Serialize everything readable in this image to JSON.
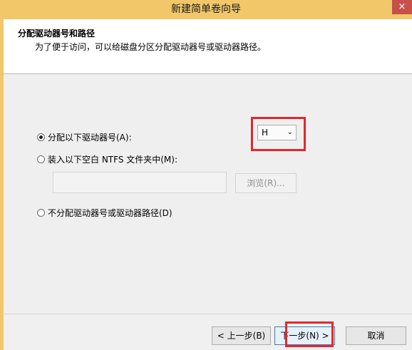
{
  "window": {
    "title": "新建简单卷向导",
    "close_icon": "×"
  },
  "header": {
    "title": "分配驱动器号和路径",
    "subtitle": "为了便于访问，可以给磁盘分区分配驱动器号或驱动器路径。"
  },
  "options": {
    "assign_letter": {
      "label": "分配以下驱动器号(A):",
      "selected": true
    },
    "mount_folder": {
      "label": "装入以下空白 NTFS 文件夹中(M):",
      "selected": false
    },
    "no_assign": {
      "label": "不分配驱动器号或驱动器路径(D)",
      "selected": false
    }
  },
  "drive_letter": {
    "value": "H",
    "chevron": "⌄"
  },
  "browse_button": {
    "label": "浏览(R)..."
  },
  "buttons": {
    "back": "< 上一步(B)",
    "next": "下一步(N) >",
    "cancel": "取消"
  },
  "colors": {
    "accent": "#f2c76a",
    "highlight": "#e4262f"
  }
}
